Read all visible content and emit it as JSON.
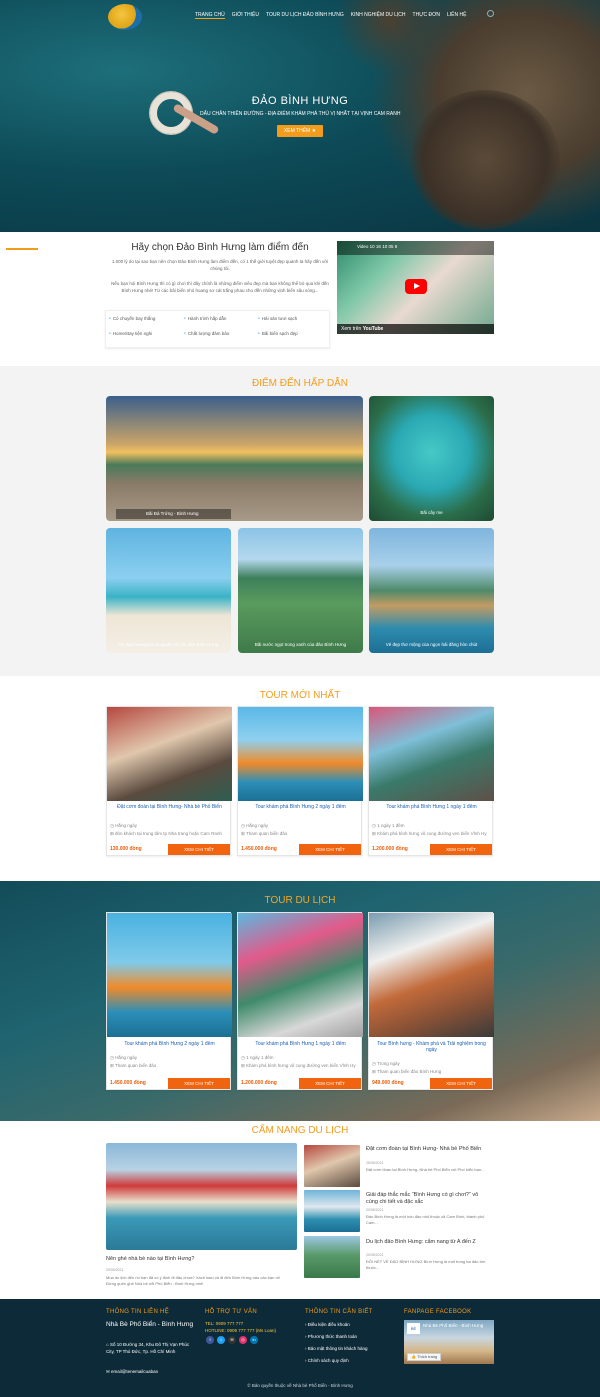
{
  "nav": {
    "items": [
      "TRANG CHỦ",
      "GIỚI THIỆU",
      "TOUR DU LỊCH ĐẢO BÌNH HƯNG",
      "KINH NGHIỆM DU LỊCH",
      "THỰC ĐƠN",
      "LIÊN HỆ"
    ]
  },
  "hero": {
    "title": "ĐẢO BÌNH HƯNG",
    "subtitle": "DẤU CHÂN THIÊN ĐƯỜNG - ĐỊA ĐIỂM KHÁM PHÁ THÚ VỊ NHẤT TẠI VỊNH CAM RANH",
    "button": "XEM THÊM"
  },
  "intro": {
    "title": "Hãy chọn Đảo Bình Hưng làm điểm đến",
    "p1": "1.000 lý do tại sao bạn nên chọn Đảo Bình Hưng làm điểm đến, có 1 thế giới tuyệt đẹp quanh ta hãy đến với chúng tôi.",
    "p2": "Nếu bạn hỏi Bình Hưng thì có gì chơi thì đây chính là những điểm siêu đẹp mà bạn không thể bỏ qua khi đến Bình Hưng nhé! Từ các bãi biển nhỏ hoang sơ cát trắng phau cho đến những vịnh biển sâu sóng...",
    "features": [
      "Có chuyến bay thẳng",
      "Hành trình hấp dẫn",
      "Hải sản tươi sạch",
      "HomeStay tiện nghi",
      "Chất lượng đảm bảo",
      "Bãi biển sạch đẹp"
    ],
    "video_title": "Video 10 16 10 05 8",
    "video_brand": "Xem trên",
    "video_yt": "YouTube"
  },
  "destinations": {
    "title": "ĐIỂM ĐẾN HẤP DẪN",
    "items": [
      "Bãi Đá Trứng - Bình Hưng",
      "Bãi cây me",
      "Vẻ đẹp hoang sơ và quyến rũ của đảo Bình Hưng",
      "Bãi nước ngọt trong xanh của đảo Bình Hưng",
      "Vẻ đẹp thơ mộng của ngọn hải đăng hòn chút"
    ]
  },
  "new_tours": {
    "title": "TOUR MỚI NHẤT",
    "cards": [
      {
        "title": "Đặt cơm đoàn tại Bình Hưng- Nhà bè Phố Biển",
        "meta1": "Hằng ngày",
        "meta2": "đón khách tại trung tâm tp Nha trang hoặc Cam Ranh",
        "price": "130.000 đồng",
        "btn": "XEM CHI TIẾT"
      },
      {
        "title": "Tour khám phá Bình Hưng 2 ngày 1 đêm",
        "meta1": "Hằng ngày",
        "meta2": "Tham quan biển đảo",
        "price": "1.450.000 đồng",
        "btn": "XEM CHI TIẾT"
      },
      {
        "title": "Tour khám phá Bình Hưng 1 ngày 1 đêm",
        "meta1": "1 ngày 1 đêm",
        "meta2": "Khám phá bình hưng vũ cung đường ven biển Vĩnh Hy",
        "price": "1.200.000 đồng",
        "btn": "XEM CHI TIẾT"
      }
    ]
  },
  "tours": {
    "title": "TOUR DU LỊCH",
    "cards": [
      {
        "title": "Tour khám phá Bình Hưng 2 ngày 1 đêm",
        "meta1": "Hằng ngày",
        "meta2": "Tham quan biển đảo",
        "price": "1.450.000 đồng",
        "btn": "XEM CHI TIẾT"
      },
      {
        "title": "Tour khám phá Bình Hưng 1 ngày 1 đêm",
        "meta1": "1 ngày 1 đêm",
        "meta2": "Khám phá bình hưng vũ cung đường ven biển Vĩnh Hy",
        "price": "1.200.000 đồng",
        "btn": "XEM CHI TIẾT"
      },
      {
        "title": "Tour Bình hưng - Khám phá và Trải nghiệm trong ngày",
        "meta1": "Trong ngày",
        "meta2": "Tham quan biển đảo Bình Hưng",
        "price": "949.000 đồng",
        "btn": "XEM CHI TIẾT"
      }
    ]
  },
  "news": {
    "title": "CẨM NANG DU LỊCH",
    "main": {
      "title": "Nên ghé nhà bè nào tại Bình Hưng?",
      "date": "20/05/2021",
      "excerpt": "Mùa du lịch đến rồi bạn đã có ý định đi đâu chưa? Xách balo và đi đến Bình Hưng nào các bạn ơi! Đừng quên ghé Nhà bè nổi Phố Biển - Bình Hưng nhé!"
    },
    "items": [
      {
        "title": "Đặt cơm đoàn tại Bình Hưng- Nhà bè Phố Biển",
        "date": "25/06/2021",
        "excerpt": "Đặt cơm đoàn tại Bình Hưng- Nhà bè Phố Biển với Phố biển bạn..."
      },
      {
        "title": "Giải đáp thắc mắc “Bình Hưng có gì chơi?” vô cùng chi tiết và đặc sắc",
        "date": "20/05/2021",
        "excerpt": "Đảo Bình Hưng là một hòn đảo nhỏ thuộc xã Cam Bình, thành phố Cam..."
      },
      {
        "title": "Du lịch đảo Bình Hưng: cẩm nang từ A đến Z",
        "date": "20/05/2021",
        "excerpt": "ĐÔI NÉT VỀ ĐẢO BÌNH HƯNG Bình Hưng là một trong ba đảo lớn thuộc..."
      }
    ]
  },
  "footer": {
    "h1": "THÔNG TIN LIÊN HỆ",
    "company": "Nhà Bè Phố Biển - Bình Hưng",
    "address": "Số 10 Đường 34, Khu Đô Thị Vạn Phúc City, TP Thủ Đức, Tp. Hồ Chí Minh",
    "email": "email@tenemailcuaban",
    "h2": "HỖ TRỢ TƯ VẤN",
    "tel": "TEL: 0909 777 777",
    "hotline": "HOTLINE: 0909 777 777 (Ms Loan)",
    "h3": "THÔNG TIN CẦN BIẾT",
    "links": [
      "Điều kiện điều khoản",
      "Phương thức thanh toán",
      "Bảo mật thông tin khách hàng",
      "Chính sách quy định"
    ],
    "h4": "FANPAGE FACEBOOK",
    "fb_name": "Nhà Bè Phố Biển - Bình Hưng",
    "fb_like": "Thích trang",
    "fb_logo": "BÈ",
    "copyright": "© Bản quyền thuộc về Nhà bè Phố Biển - Bình Hưng"
  }
}
